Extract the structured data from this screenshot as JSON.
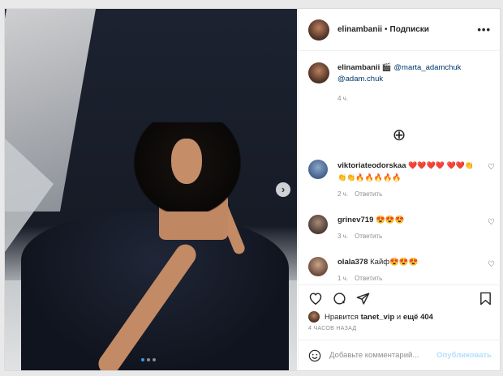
{
  "post": {
    "author": "elinambanii",
    "follow_label": "Подписки",
    "more_label": "•••",
    "caption": {
      "author": "elinambanii",
      "emoji": "🎬",
      "mention1": "@marta_adamchuk",
      "mention2": "@adam.chuk",
      "time": "4 ч."
    },
    "load_more": "⊕",
    "comments": [
      {
        "user": "viktoriateodorskaa",
        "text": "❤️❤️❤️❤️ ❤️❤️👏👏👏🔥🔥🔥🔥🔥",
        "time": "2 ч.",
        "reply": "Ответить"
      },
      {
        "user": "grinev719",
        "text": "😍😍😍",
        "time": "3 ч.",
        "reply": "Ответить"
      },
      {
        "user": "olala378",
        "text": "Кайф😍😍😍",
        "time": "1 ч.",
        "reply": "Ответить"
      }
    ],
    "likes": {
      "prefix": "Нравится",
      "user": "tanet_vip",
      "middle": "и",
      "rest": "ещё 404"
    },
    "ago": "4 ЧАСОВ НАЗАД",
    "add_comment_placeholder": "Добавьте комментарий...",
    "publish_label": "Опубликовать"
  },
  "icons": [
    "chevron-right-icon",
    "plus-circle-icon",
    "heart-icon",
    "comment-icon",
    "share-icon",
    "bookmark-icon",
    "smile-icon",
    "more-icon"
  ],
  "colors": {
    "link_blue": "#3897f0",
    "publish_disabled": "#b2dffc",
    "muted": "#8e8e8e",
    "heart_red": "#ed4956"
  }
}
